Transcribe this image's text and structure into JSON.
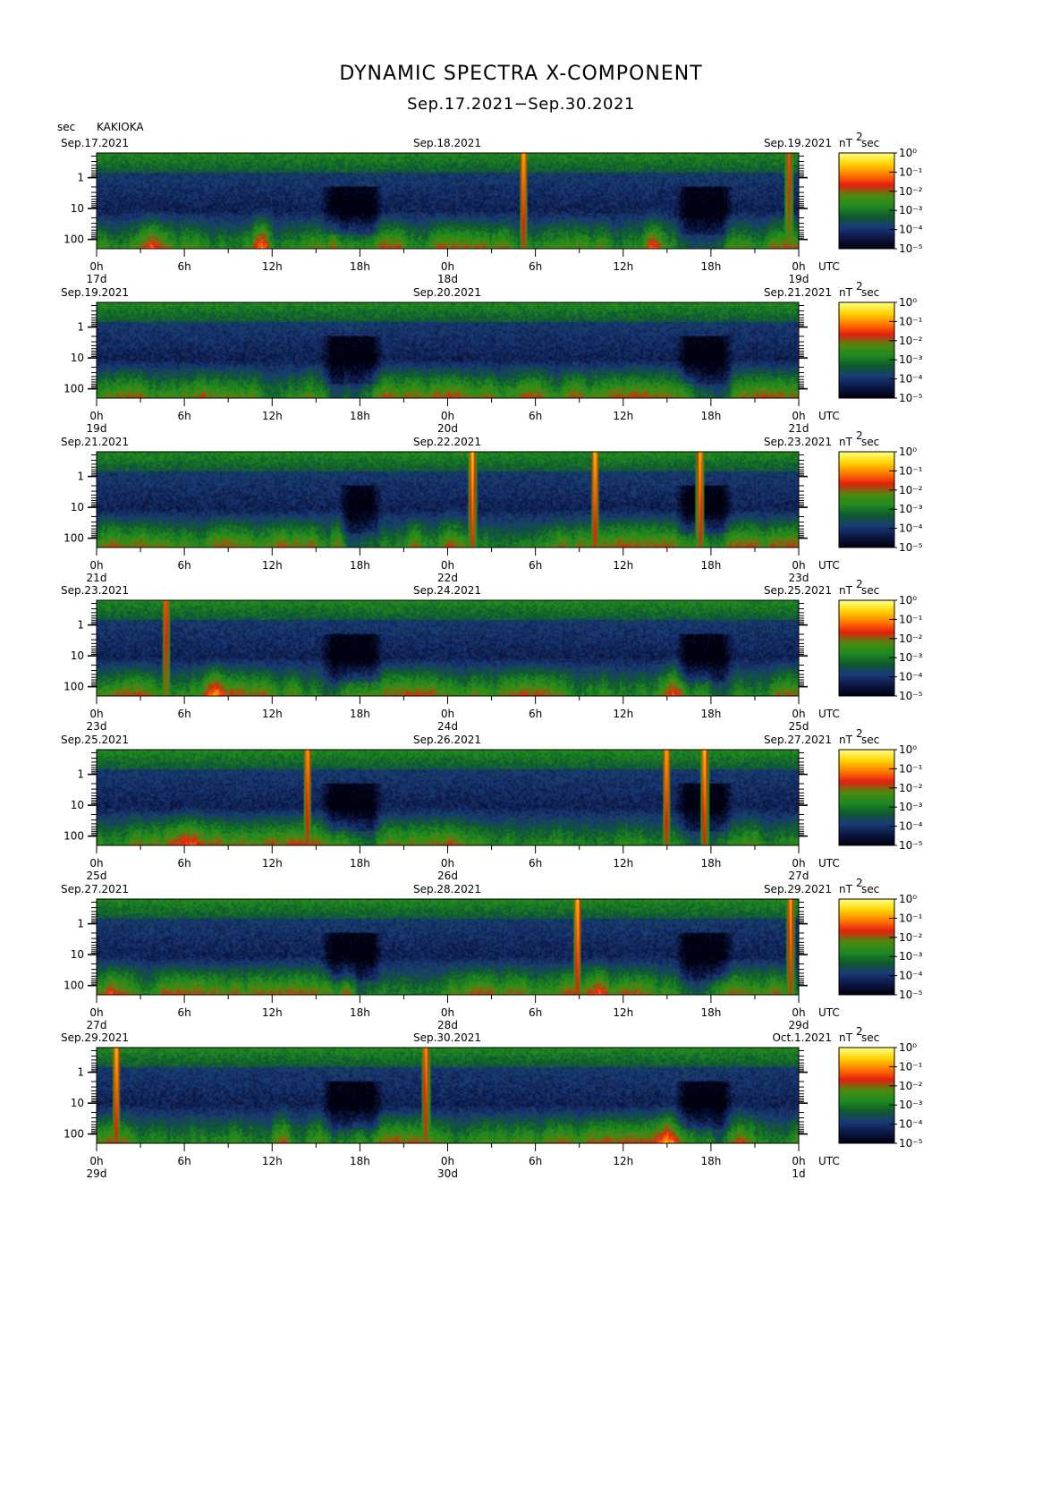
{
  "title": "DYNAMIC SPECTRA X-COMPONENT",
  "subtitle": "Sep.17.2021−Sep.30.2021",
  "yunit": "sec",
  "station": "KAKIOKA",
  "cbar_unit": "nT",
  "cbar_unit_exp": "2",
  "cbar_unit_tail": "sec",
  "utc_label": "UTC",
  "colors": {
    "scale": [
      "#000010",
      "#0c1844",
      "#1a3a78",
      "#0f5a2e",
      "#1f8a1f",
      "#4c8a10",
      "#e61e10",
      "#ff7a00",
      "#ffd400",
      "#ffff80"
    ]
  },
  "chart_data": [
    {
      "type": "heatmap",
      "date_left": "Sep.17.2021",
      "date_mid": "Sep.18.2021",
      "date_right": "Sep.19.2021",
      "day_labels": [
        "17d",
        "18d",
        "19d"
      ],
      "x_ticks": [
        "0h",
        "6h",
        "12h",
        "18h",
        "0h",
        "6h",
        "12h",
        "18h",
        "0h"
      ],
      "y_ticks": [
        "1",
        "10",
        "100"
      ],
      "cbar_ticks": [
        "10⁰",
        "10⁻¹",
        "10⁻²",
        "10⁻³",
        "10⁻⁴",
        "10⁻⁵"
      ],
      "xlim_hours": [
        0,
        48
      ],
      "ylim_sec_log10": [
        -0.8,
        2.3
      ],
      "spikes": [
        {
          "t": 29.2,
          "s": 0.95
        },
        {
          "t": 47.4,
          "s": 0.6
        }
      ],
      "bursts": [
        {
          "t": 11.3,
          "w": 0.8,
          "s": 0.9
        },
        {
          "t": 16.2,
          "w": 0.6,
          "s": 0.8
        },
        {
          "t": 38.2,
          "w": 1.0,
          "s": 0.7
        },
        {
          "t": 3.8,
          "w": 1.6,
          "s": 0.6
        }
      ],
      "quiet": [
        {
          "t0": 15.3,
          "t1": 19.6
        },
        {
          "t0": 39.6,
          "t1": 43.6
        }
      ]
    },
    {
      "type": "heatmap",
      "date_left": "Sep.19.2021",
      "date_mid": "Sep.20.2021",
      "date_right": "Sep.21.2021",
      "day_labels": [
        "19d",
        "20d",
        "21d"
      ],
      "x_ticks": [
        "0h",
        "6h",
        "12h",
        "18h",
        "0h",
        "6h",
        "12h",
        "18h",
        "0h"
      ],
      "y_ticks": [
        "1",
        "10",
        "100"
      ],
      "cbar_ticks": [
        "10⁰",
        "10⁻¹",
        "10⁻²",
        "10⁻³",
        "10⁻⁴",
        "10⁻⁵"
      ],
      "xlim_hours": [
        0,
        48
      ],
      "ylim_sec_log10": [
        -0.8,
        2.3
      ],
      "spikes": [],
      "bursts": [
        {
          "t": 40.5,
          "w": 0.8,
          "s": 0.6
        },
        {
          "t": 14.5,
          "w": 0.5,
          "s": 0.4
        }
      ],
      "quiet": [
        {
          "t0": 15.3,
          "t1": 19.6
        },
        {
          "t0": 39.6,
          "t1": 43.6
        }
      ]
    },
    {
      "type": "heatmap",
      "date_left": "Sep.21.2021",
      "date_mid": "Sep.22.2021",
      "date_right": "Sep.23.2021",
      "day_labels": [
        "21d",
        "22d",
        "23d"
      ],
      "x_ticks": [
        "0h",
        "6h",
        "12h",
        "18h",
        "0h",
        "6h",
        "12h",
        "18h",
        "0h"
      ],
      "y_ticks": [
        "1",
        "10",
        "100"
      ],
      "cbar_ticks": [
        "10⁰",
        "10⁻¹",
        "10⁻²",
        "10⁻³",
        "10⁻⁴",
        "10⁻⁵"
      ],
      "xlim_hours": [
        0,
        48
      ],
      "ylim_sec_log10": [
        -0.8,
        2.3
      ],
      "spikes": [
        {
          "t": 25.7,
          "s": 1.0
        },
        {
          "t": 34.1,
          "s": 1.0
        },
        {
          "t": 41.3,
          "s": 0.95
        }
      ],
      "bursts": [
        {
          "t": 16.5,
          "w": 0.7,
          "s": 0.7
        },
        {
          "t": 1.0,
          "w": 1.0,
          "s": 0.6
        },
        {
          "t": 24.5,
          "w": 1.5,
          "s": 0.6
        }
      ],
      "quiet": [
        {
          "t0": 16.5,
          "t1": 19.5
        },
        {
          "t0": 39.6,
          "t1": 43.6
        }
      ]
    },
    {
      "type": "heatmap",
      "date_left": "Sep.23.2021",
      "date_mid": "Sep.24.2021",
      "date_right": "Sep.25.2021",
      "day_labels": [
        "23d",
        "24d",
        "25d"
      ],
      "x_ticks": [
        "0h",
        "6h",
        "12h",
        "18h",
        "0h",
        "6h",
        "12h",
        "18h",
        "0h"
      ],
      "y_ticks": [
        "1",
        "10",
        "100"
      ],
      "cbar_ticks": [
        "10⁰",
        "10⁻¹",
        "10⁻²",
        "10⁻³",
        "10⁻⁴",
        "10⁻⁵"
      ],
      "xlim_hours": [
        0,
        48
      ],
      "ylim_sec_log10": [
        -0.8,
        2.3
      ],
      "spikes": [
        {
          "t": 4.7,
          "s": 0.7
        }
      ],
      "bursts": [
        {
          "t": 39.5,
          "w": 1.0,
          "s": 0.9
        },
        {
          "t": 8.0,
          "w": 1.0,
          "s": 0.6
        }
      ],
      "quiet": [
        {
          "t0": 15.3,
          "t1": 19.6
        },
        {
          "t0": 39.6,
          "t1": 43.6
        }
      ]
    },
    {
      "type": "heatmap",
      "date_left": "Sep.25.2021",
      "date_mid": "Sep.26.2021",
      "date_right": "Sep.27.2021",
      "day_labels": [
        "25d",
        "26d",
        "27d"
      ],
      "x_ticks": [
        "0h",
        "6h",
        "12h",
        "18h",
        "0h",
        "6h",
        "12h",
        "18h",
        "0h"
      ],
      "y_ticks": [
        "1",
        "10",
        "100"
      ],
      "cbar_ticks": [
        "10⁰",
        "10⁻¹",
        "10⁻²",
        "10⁻³",
        "10⁻⁴",
        "10⁻⁵"
      ],
      "xlim_hours": [
        0,
        48
      ],
      "ylim_sec_log10": [
        -0.8,
        2.3
      ],
      "spikes": [
        {
          "t": 14.4,
          "s": 0.9
        },
        {
          "t": 39.0,
          "s": 0.95
        },
        {
          "t": 41.6,
          "s": 1.0
        }
      ],
      "bursts": [
        {
          "t": 6.5,
          "w": 1.2,
          "s": 0.6
        },
        {
          "t": 2.5,
          "w": 1.0,
          "s": 0.5
        }
      ],
      "quiet": [
        {
          "t0": 15.3,
          "t1": 19.6
        },
        {
          "t0": 39.6,
          "t1": 43.6
        }
      ]
    },
    {
      "type": "heatmap",
      "date_left": "Sep.27.2021",
      "date_mid": "Sep.28.2021",
      "date_right": "Sep.29.2021",
      "day_labels": [
        "27d",
        "28d",
        "29d"
      ],
      "x_ticks": [
        "0h",
        "6h",
        "12h",
        "18h",
        "0h",
        "6h",
        "12h",
        "18h",
        "0h"
      ],
      "y_ticks": [
        "1",
        "10",
        "100"
      ],
      "cbar_ticks": [
        "10⁰",
        "10⁻¹",
        "10⁻²",
        "10⁻³",
        "10⁻⁴",
        "10⁻⁵"
      ],
      "xlim_hours": [
        0,
        48
      ],
      "ylim_sec_log10": [
        -0.8,
        2.3
      ],
      "spikes": [
        {
          "t": 32.9,
          "s": 1.0
        },
        {
          "t": 47.5,
          "s": 0.9
        }
      ],
      "bursts": [
        {
          "t": 34.5,
          "w": 0.8,
          "s": 0.8
        },
        {
          "t": 17.0,
          "w": 0.8,
          "s": 0.6
        },
        {
          "t": 1.5,
          "w": 2.0,
          "s": 0.7
        }
      ],
      "quiet": [
        {
          "t0": 15.3,
          "t1": 19.6
        },
        {
          "t0": 39.6,
          "t1": 43.6
        }
      ]
    },
    {
      "type": "heatmap",
      "date_left": "Sep.29.2021",
      "date_mid": "Sep.30.2021",
      "date_right": "Oct.1.2021",
      "day_labels": [
        "29d",
        "30d",
        "1d"
      ],
      "x_ticks": [
        "0h",
        "6h",
        "12h",
        "18h",
        "0h",
        "6h",
        "12h",
        "18h",
        "0h"
      ],
      "y_ticks": [
        "1",
        "10",
        "100"
      ],
      "cbar_ticks": [
        "10⁰",
        "10⁻¹",
        "10⁻²",
        "10⁻³",
        "10⁻⁴",
        "10⁻⁵"
      ],
      "xlim_hours": [
        0,
        48
      ],
      "ylim_sec_log10": [
        -0.8,
        2.3
      ],
      "spikes": [
        {
          "t": 1.3,
          "s": 1.0
        },
        {
          "t": 22.5,
          "s": 0.85
        }
      ],
      "bursts": [
        {
          "t": 12.7,
          "w": 0.8,
          "s": 0.7
        },
        {
          "t": 39.0,
          "w": 1.0,
          "s": 0.7
        },
        {
          "t": 44.0,
          "w": 1.5,
          "s": 0.6
        }
      ],
      "quiet": [
        {
          "t0": 15.3,
          "t1": 19.6
        },
        {
          "t0": 39.6,
          "t1": 43.6
        }
      ]
    }
  ]
}
